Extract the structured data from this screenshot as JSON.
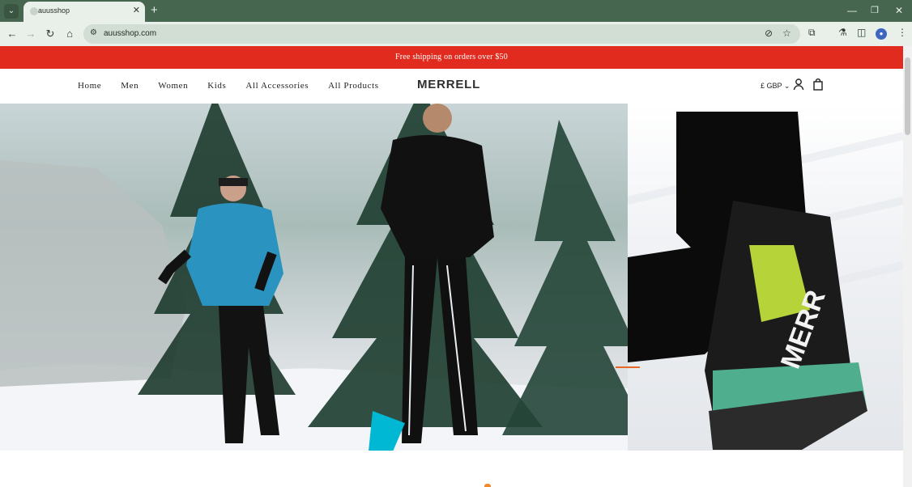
{
  "browser": {
    "tab_title": "auusshop",
    "url": "auusshop.com",
    "icons": [
      "tab-menu-icon",
      "favicon",
      "close-icon",
      "new-tab-icon",
      "minimize-icon",
      "restore-icon",
      "window-close-icon",
      "back-icon",
      "forward-icon",
      "reload-icon",
      "home-icon",
      "site-info-icon",
      "eye-off-icon",
      "star-icon",
      "extensions-icon",
      "labs-icon",
      "side-panel-icon",
      "profile-icon",
      "more-icon"
    ]
  },
  "site": {
    "announcement": "Free shipping on orders over $50",
    "nav": [
      "Home",
      "Men",
      "Women",
      "Kids",
      "All Accessories",
      "All Products"
    ],
    "logo": "MERRELL",
    "currency": "£ GBP",
    "header_icons": [
      "account-icon",
      "cart-icon"
    ]
  },
  "hero": {
    "type": "image-slider",
    "active_indicator_color": "#e56a2a"
  },
  "colors": {
    "announcement_bg": "#e12b1f",
    "browser_frame": "#476650",
    "toolbar_bg": "#e9f0ea"
  }
}
